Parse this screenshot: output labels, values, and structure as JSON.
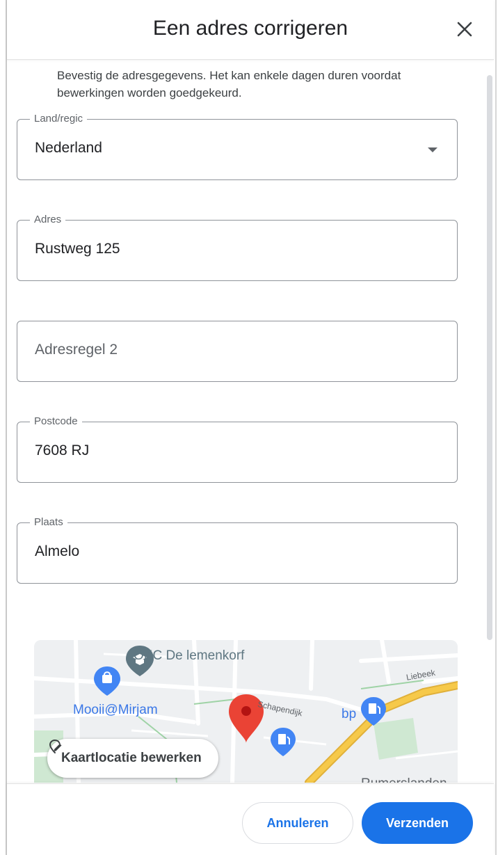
{
  "dialog": {
    "title": "Een adres corrigeren",
    "intro": "Bevestig de adresgegevens. Het kan enkele dagen duren voordat bewerkingen worden goedgekeurd."
  },
  "fields": {
    "country": {
      "label": "Land/regic",
      "value": "Nederland"
    },
    "address": {
      "label": "Adres",
      "value": "Rustweg 125"
    },
    "address2": {
      "placeholder": "Adresregel 2"
    },
    "postcode": {
      "label": "Postcode",
      "value": "7608 RJ"
    },
    "city": {
      "label": "Plaats",
      "value": "Almelo"
    }
  },
  "map": {
    "places": {
      "okc": "OKC De lemenkorf",
      "mooii": "Mooii@Mirjam",
      "schapendijk": "Schapendijk",
      "bp": "bp",
      "liebeek": "Liebeek",
      "area": "Rumerslanden"
    },
    "edit_location_label": "Kaartlocatie bewerken",
    "colors": {
      "pin": "#ea4335",
      "poi": "#4285f4",
      "road_major": "#f6c94a",
      "park": "#cfe8d2"
    }
  },
  "footer": {
    "cancel_label": "Annuleren",
    "submit_label": "Verzenden"
  },
  "colors": {
    "accent": "#1a73e8"
  }
}
